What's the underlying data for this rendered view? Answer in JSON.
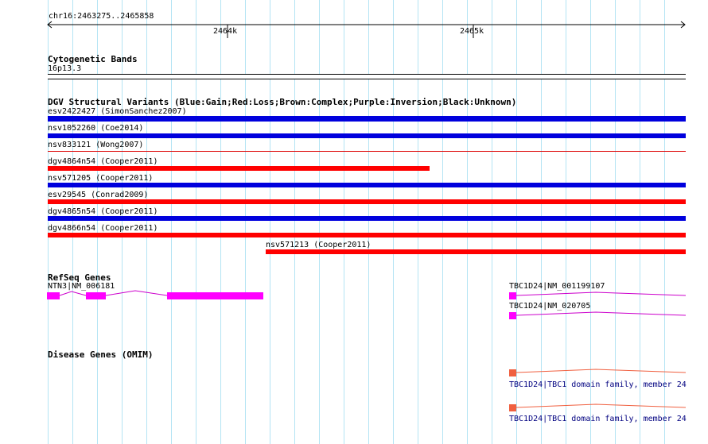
{
  "ruler": {
    "range": "chr16:2463275..2465858",
    "tick_1": "2464k",
    "tick_2": "2465k"
  },
  "tracks": {
    "cytoband": {
      "title": "Cytogenetic Bands",
      "band": "16p13.3"
    },
    "dgv": {
      "title": "DGV Structural Variants (Blue:Gain;Red:Loss;Brown:Complex;Purple:Inversion;Black:Unknown)",
      "features": [
        {
          "label": "esv2422427 (SimonSanchez2007)",
          "type": "Gain",
          "color": "#0000dd"
        },
        {
          "label": "nsv1052260 (Coe2014)",
          "type": "Gain",
          "color": "#0000dd"
        },
        {
          "label": "nsv833121 (Wong2007)",
          "type": "Loss",
          "color": "#dd0000"
        },
        {
          "label": "dgv4864n54 (Cooper2011)",
          "type": "Loss",
          "color": "#ff0000"
        },
        {
          "label": "nsv571205 (Cooper2011)",
          "type": "Gain",
          "color": "#0000dd"
        },
        {
          "label": "esv29545 (Conrad2009)",
          "type": "Loss",
          "color": "#ff0000"
        },
        {
          "label": "dgv4865n54 (Cooper2011)",
          "type": "Gain",
          "color": "#0000dd"
        },
        {
          "label": "dgv4866n54 (Cooper2011)",
          "type": "Loss",
          "color": "#ff0000"
        },
        {
          "label": "nsv571213 (Cooper2011)",
          "type": "Loss",
          "color": "#ff0000"
        }
      ]
    },
    "refseq": {
      "title": "RefSeq Genes",
      "genes": [
        {
          "label": "NTN3|NM_006181",
          "color": "#ff00ff"
        },
        {
          "label": "TBC1D24|NM_001199107",
          "color": "#ff00ff"
        },
        {
          "label": "TBC1D24|NM_020705",
          "color": "#ff00ff"
        }
      ]
    },
    "omim": {
      "title": "Disease Genes (OMIM)",
      "genes": [
        {
          "label": "TBC1D24|TBC1 domain family, member 24",
          "color": "#f06040"
        },
        {
          "label": "TBC1D24|TBC1 domain family, member 24",
          "color": "#f06040"
        }
      ]
    }
  }
}
